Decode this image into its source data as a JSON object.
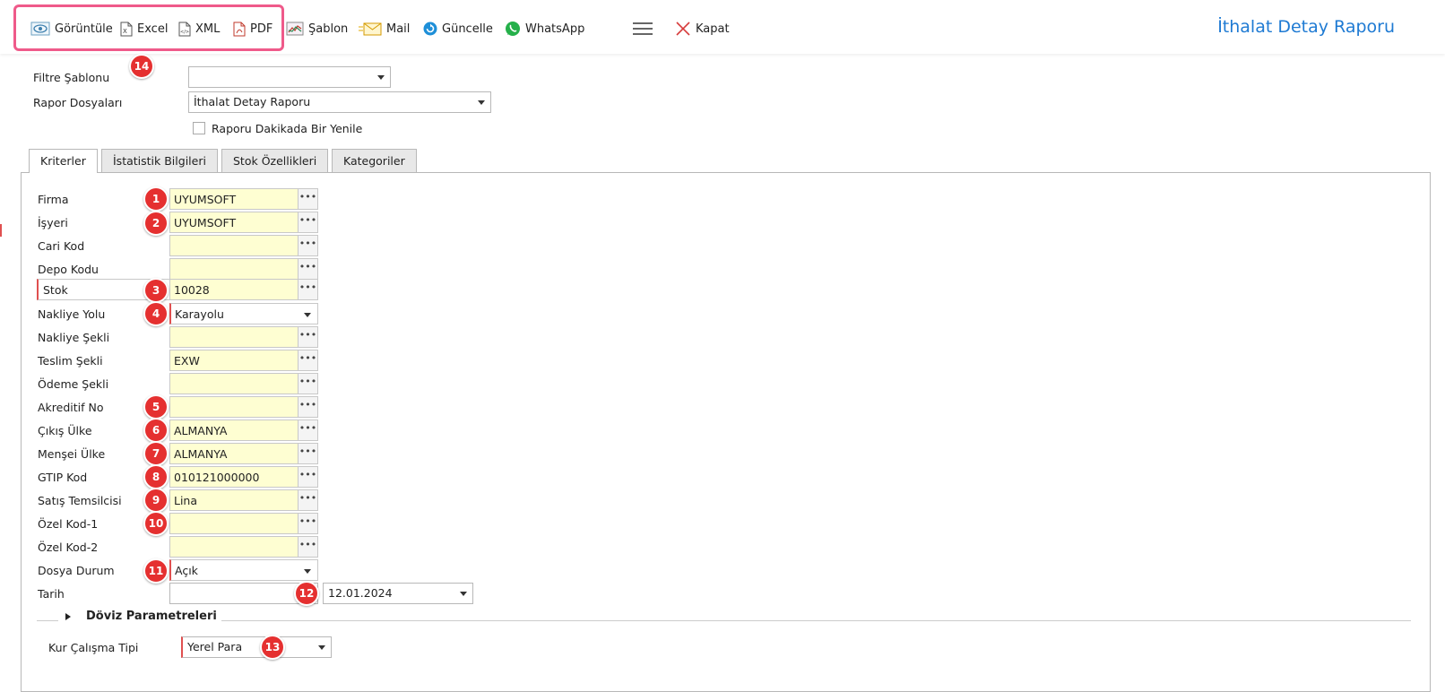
{
  "toolbar": {
    "view_label": "Görüntüle",
    "excel_label": "Excel",
    "xml_label": "XML",
    "pdf_label": "PDF",
    "template_label": "Şablon",
    "mail_label": "Mail",
    "update_label": "Güncelle",
    "whatsapp_label": "WhatsApp",
    "close_label": "Kapat",
    "highlight_badge": "14"
  },
  "report_title": "İthalat Detay Raporu",
  "filters": {
    "template_label": "Filtre Şablonu",
    "template_value": "",
    "report_files_label": "Rapor Dosyaları",
    "report_files_value": "İthalat Detay Raporu",
    "auto_refresh_label": "Raporu Dakikada Bir Yenile",
    "auto_refresh_checked": false
  },
  "tabs": [
    {
      "label": "Kriterler",
      "active": true
    },
    {
      "label": "İstatistik Bilgileri",
      "active": false
    },
    {
      "label": "Stok Özellikleri",
      "active": false
    },
    {
      "label": "Kategoriler",
      "active": false
    }
  ],
  "criteria": {
    "firma": {
      "label": "Firma",
      "value": "UYUMSOFT",
      "badge": "1"
    },
    "isyeri": {
      "label": "İşyeri",
      "value": "UYUMSOFT",
      "badge": "2"
    },
    "cari_kod": {
      "label": "Cari Kod",
      "value": ""
    },
    "depo_kodu": {
      "label": "Depo Kodu",
      "value": ""
    },
    "stok": {
      "label": "Stok",
      "value": "10028",
      "badge": "3"
    },
    "nakliye_yolu": {
      "label": "Nakliye Yolu",
      "value": "Karayolu",
      "badge": "4"
    },
    "nakliye_sekli": {
      "label": "Nakliye Şekli",
      "value": ""
    },
    "teslim_sekli": {
      "label": "Teslim Şekli",
      "value": "EXW"
    },
    "odeme_sekli": {
      "label": "Ödeme Şekli",
      "value": ""
    },
    "akreditif_no": {
      "label": "Akreditif No",
      "value": "",
      "badge": "5"
    },
    "cikis_ulke": {
      "label": "Çıkış Ülke",
      "value": "ALMANYA",
      "badge": "6"
    },
    "mensei_ulke": {
      "label": "Menşei Ülke",
      "value": "ALMANYA",
      "badge": "7"
    },
    "gtip_kod": {
      "label": "GTIP Kod",
      "value": "010121000000",
      "badge": "8"
    },
    "satis_temsilcisi": {
      "label": "Satış Temsilcisi",
      "value": "Lina",
      "badge": "9"
    },
    "ozel_kod_1": {
      "label": "Özel Kod-1",
      "value": "",
      "badge": "10"
    },
    "ozel_kod_2": {
      "label": "Özel Kod-2",
      "value": ""
    },
    "dosya_durum": {
      "label": "Dosya Durum",
      "value": "Açık",
      "badge": "11"
    },
    "tarih": {
      "label": "Tarih",
      "start_value": "",
      "end_value": "12.01.2024",
      "badge": "12"
    }
  },
  "currency": {
    "section_title": "Döviz Parametreleri",
    "rate_type_label": "Kur Çalışma Tipi",
    "rate_type_value": "Yerel Para",
    "badge": "13"
  },
  "colors": {
    "accent": "#1e7ad3",
    "badge": "#e53030",
    "highlight": "#ef5a8a",
    "field_bg": "#fefed2"
  }
}
